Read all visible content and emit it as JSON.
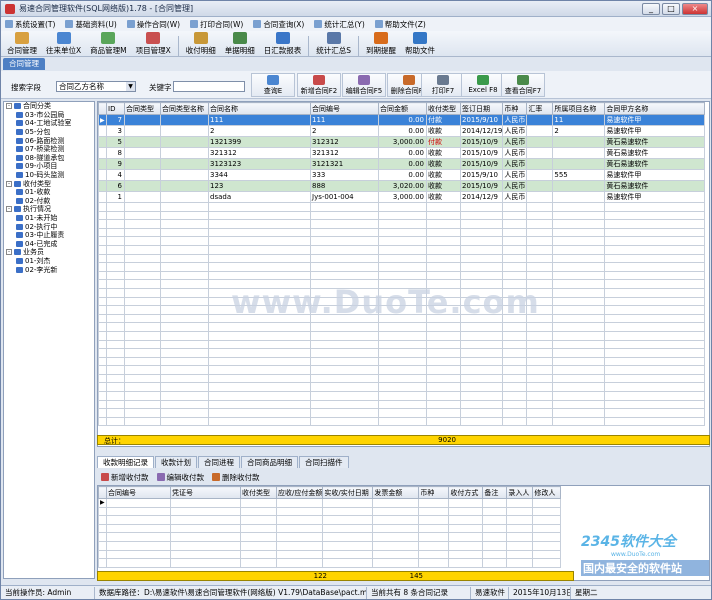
{
  "window": {
    "title": "易速合同管理软件(SQL网络版)1.78 - [合同管理]",
    "buttons": [
      "_",
      "□",
      "×"
    ]
  },
  "menu": [
    "系统设置(T)",
    "基础资料(U)",
    "操作合同(W)",
    "打印合同(W)",
    "合同查询(X)",
    "统计汇总(Y)",
    "帮助文件(Z)"
  ],
  "toolbar": [
    {
      "label": "合同管理",
      "color": "#d8a040"
    },
    {
      "label": "往来单位X",
      "color": "#4b86d1"
    },
    {
      "label": "商品管理M",
      "color": "#5aa65a"
    },
    {
      "label": "项目管理X",
      "color": "#c95050"
    },
    {
      "label": "收付明细",
      "color": "#c89838"
    },
    {
      "label": "单据明细",
      "color": "#4a8a4a"
    },
    {
      "label": "日汇款报表",
      "color": "#3a76c8"
    },
    {
      "label": "统计汇总S",
      "color": "#5a78a8"
    },
    {
      "label": "到期提醒",
      "color": "#d86c1c"
    },
    {
      "label": "帮助文件",
      "color": "#3477c6"
    }
  ],
  "active_tab": "合同管理",
  "search": {
    "field_label": "搜索字段",
    "field_value": "合同乙方名称",
    "keyword_label": "关键字",
    "keyword_value": "",
    "buttons": [
      {
        "label": "查询E",
        "color": "#4b86d1"
      },
      {
        "label": "新增合同F2",
        "color": "#c84a4a"
      },
      {
        "label": "编辑合同F5",
        "color": "#8a6ab0"
      },
      {
        "label": "删除合同F6",
        "color": "#c86a2a"
      },
      {
        "label": "打印F7",
        "color": "#6a7a90"
      },
      {
        "label": "Excel F8",
        "color": "#3a9a4a"
      },
      {
        "label": "查看合同F7",
        "color": "#4a8a4a"
      }
    ]
  },
  "tree": [
    {
      "level": 0,
      "toggle": "-",
      "label": "合同分类"
    },
    {
      "level": 1,
      "label": "03-市公园局"
    },
    {
      "level": 1,
      "label": "04-工地试验室"
    },
    {
      "level": 1,
      "label": "05-分包"
    },
    {
      "level": 1,
      "label": "06-路面检测"
    },
    {
      "level": 1,
      "label": "07-桥梁检测"
    },
    {
      "level": 1,
      "label": "08-隧道承包"
    },
    {
      "level": 1,
      "label": "09-小项目"
    },
    {
      "level": 1,
      "label": "10-码头监测"
    },
    {
      "level": 0,
      "toggle": "-",
      "label": "收付类型"
    },
    {
      "level": 1,
      "label": "01-收款"
    },
    {
      "level": 1,
      "label": "02-付款"
    },
    {
      "level": 0,
      "toggle": "-",
      "label": "执行情况"
    },
    {
      "level": 1,
      "label": "01-未开始"
    },
    {
      "level": 1,
      "label": "02-执行中"
    },
    {
      "level": 1,
      "label": "03-中止履责"
    },
    {
      "level": 1,
      "label": "04-已完成"
    },
    {
      "level": 0,
      "toggle": "-",
      "label": "业务员"
    },
    {
      "level": 1,
      "label": "01-刘杰"
    },
    {
      "level": 1,
      "label": "02-李光新"
    }
  ],
  "grid": {
    "columns": [
      "ID",
      "合同类型",
      "合同类型名称",
      "合同名称",
      "合同编号",
      "合同金额",
      "收付类型",
      "签订日期",
      "币种",
      "汇率",
      "所属项目名称",
      "合同甲方名称"
    ],
    "rows": [
      {
        "id": "7",
        "type": "",
        "type_name": "",
        "name": "111",
        "no": "111",
        "amount": "0.00",
        "pay": "付款",
        "date": "2015/9/10",
        "cur": "人民币",
        "rate": "",
        "proj": "11",
        "party": "易速软件甲",
        "style": "sel"
      },
      {
        "id": "3",
        "type": "",
        "type_name": "",
        "name": "2",
        "no": "2",
        "amount": "0.00",
        "pay": "收款",
        "date": "2014/12/19",
        "cur": "人民币",
        "rate": "",
        "proj": "2",
        "party": "易速软件甲",
        "style": ""
      },
      {
        "id": "5",
        "type": "",
        "type_name": "",
        "name": "1321399",
        "no": "312312",
        "amount": "3,000.00",
        "pay": "付款",
        "date": "2015/10/9",
        "cur": "人民币",
        "rate": "",
        "proj": "",
        "party": "黄石易速软件",
        "style": "green"
      },
      {
        "id": "8",
        "type": "",
        "type_name": "",
        "name": "321312",
        "no": "321312",
        "amount": "0.00",
        "pay": "收款",
        "date": "2015/10/9",
        "cur": "人民币",
        "rate": "",
        "proj": "",
        "party": "黄石易速软件",
        "style": ""
      },
      {
        "id": "9",
        "type": "",
        "type_name": "",
        "name": "3123123",
        "no": "3121321",
        "amount": "0.00",
        "pay": "收款",
        "date": "2015/10/9",
        "cur": "人民币",
        "rate": "",
        "proj": "",
        "party": "黄石易速软件",
        "style": "green"
      },
      {
        "id": "4",
        "type": "",
        "type_name": "",
        "name": "3344",
        "no": "333",
        "amount": "0.00",
        "pay": "收款",
        "date": "2015/9/10",
        "cur": "人民币",
        "rate": "",
        "proj": "555",
        "party": "易速软件甲",
        "style": ""
      },
      {
        "id": "6",
        "type": "",
        "type_name": "",
        "name": "123",
        "no": "888",
        "amount": "3,020.00",
        "pay": "收款",
        "date": "2015/10/9",
        "cur": "人民币",
        "rate": "",
        "proj": "",
        "party": "黄石易速软件",
        "style": "green"
      },
      {
        "id": "1",
        "type": "",
        "type_name": "",
        "name": "dsada",
        "no": "Jys-001-004",
        "amount": "3,000.00",
        "pay": "收款",
        "date": "2014/12/9",
        "cur": "人民币",
        "rate": "",
        "proj": "",
        "party": "易速软件甲",
        "style": ""
      }
    ],
    "total_label": "总计：",
    "total_value": "9020"
  },
  "subtabs": [
    "收款明细记录",
    "收款计划",
    "合同进程",
    "合同商品明细",
    "合同扫描件"
  ],
  "subtools": [
    {
      "label": "新增收付款",
      "color": "#c84a4a"
    },
    {
      "label": "编辑收付款",
      "color": "#8a6ab0"
    },
    {
      "label": "删除收付款",
      "color": "#c86a2a"
    }
  ],
  "subgrid": {
    "columns": [
      "合同编号",
      "凭证号",
      "收付类型",
      "应收/应付金额",
      "实收/实付日期",
      "发票金额",
      "币种",
      "收付方式",
      "备注",
      "录入人",
      "修改人"
    ],
    "total_a": "122",
    "total_b": "145"
  },
  "status": {
    "operator": "当前操作员: Admin",
    "db_path": "数据库路径：D:\\易速软件\\易速合同管理软件(网络版) V1.79\\DataBase\\pact.mdb",
    "count": "当前共有 8 条合同记录",
    "company": "易速软件",
    "date": "2015年10月13日",
    "weekday": "星期二"
  },
  "watermark": {
    "center": "www.DuoTe.com",
    "logo": "2345软件大全",
    "logo_sub": "www.DuoTe.com",
    "slogan": "国内最安全的软件站"
  }
}
